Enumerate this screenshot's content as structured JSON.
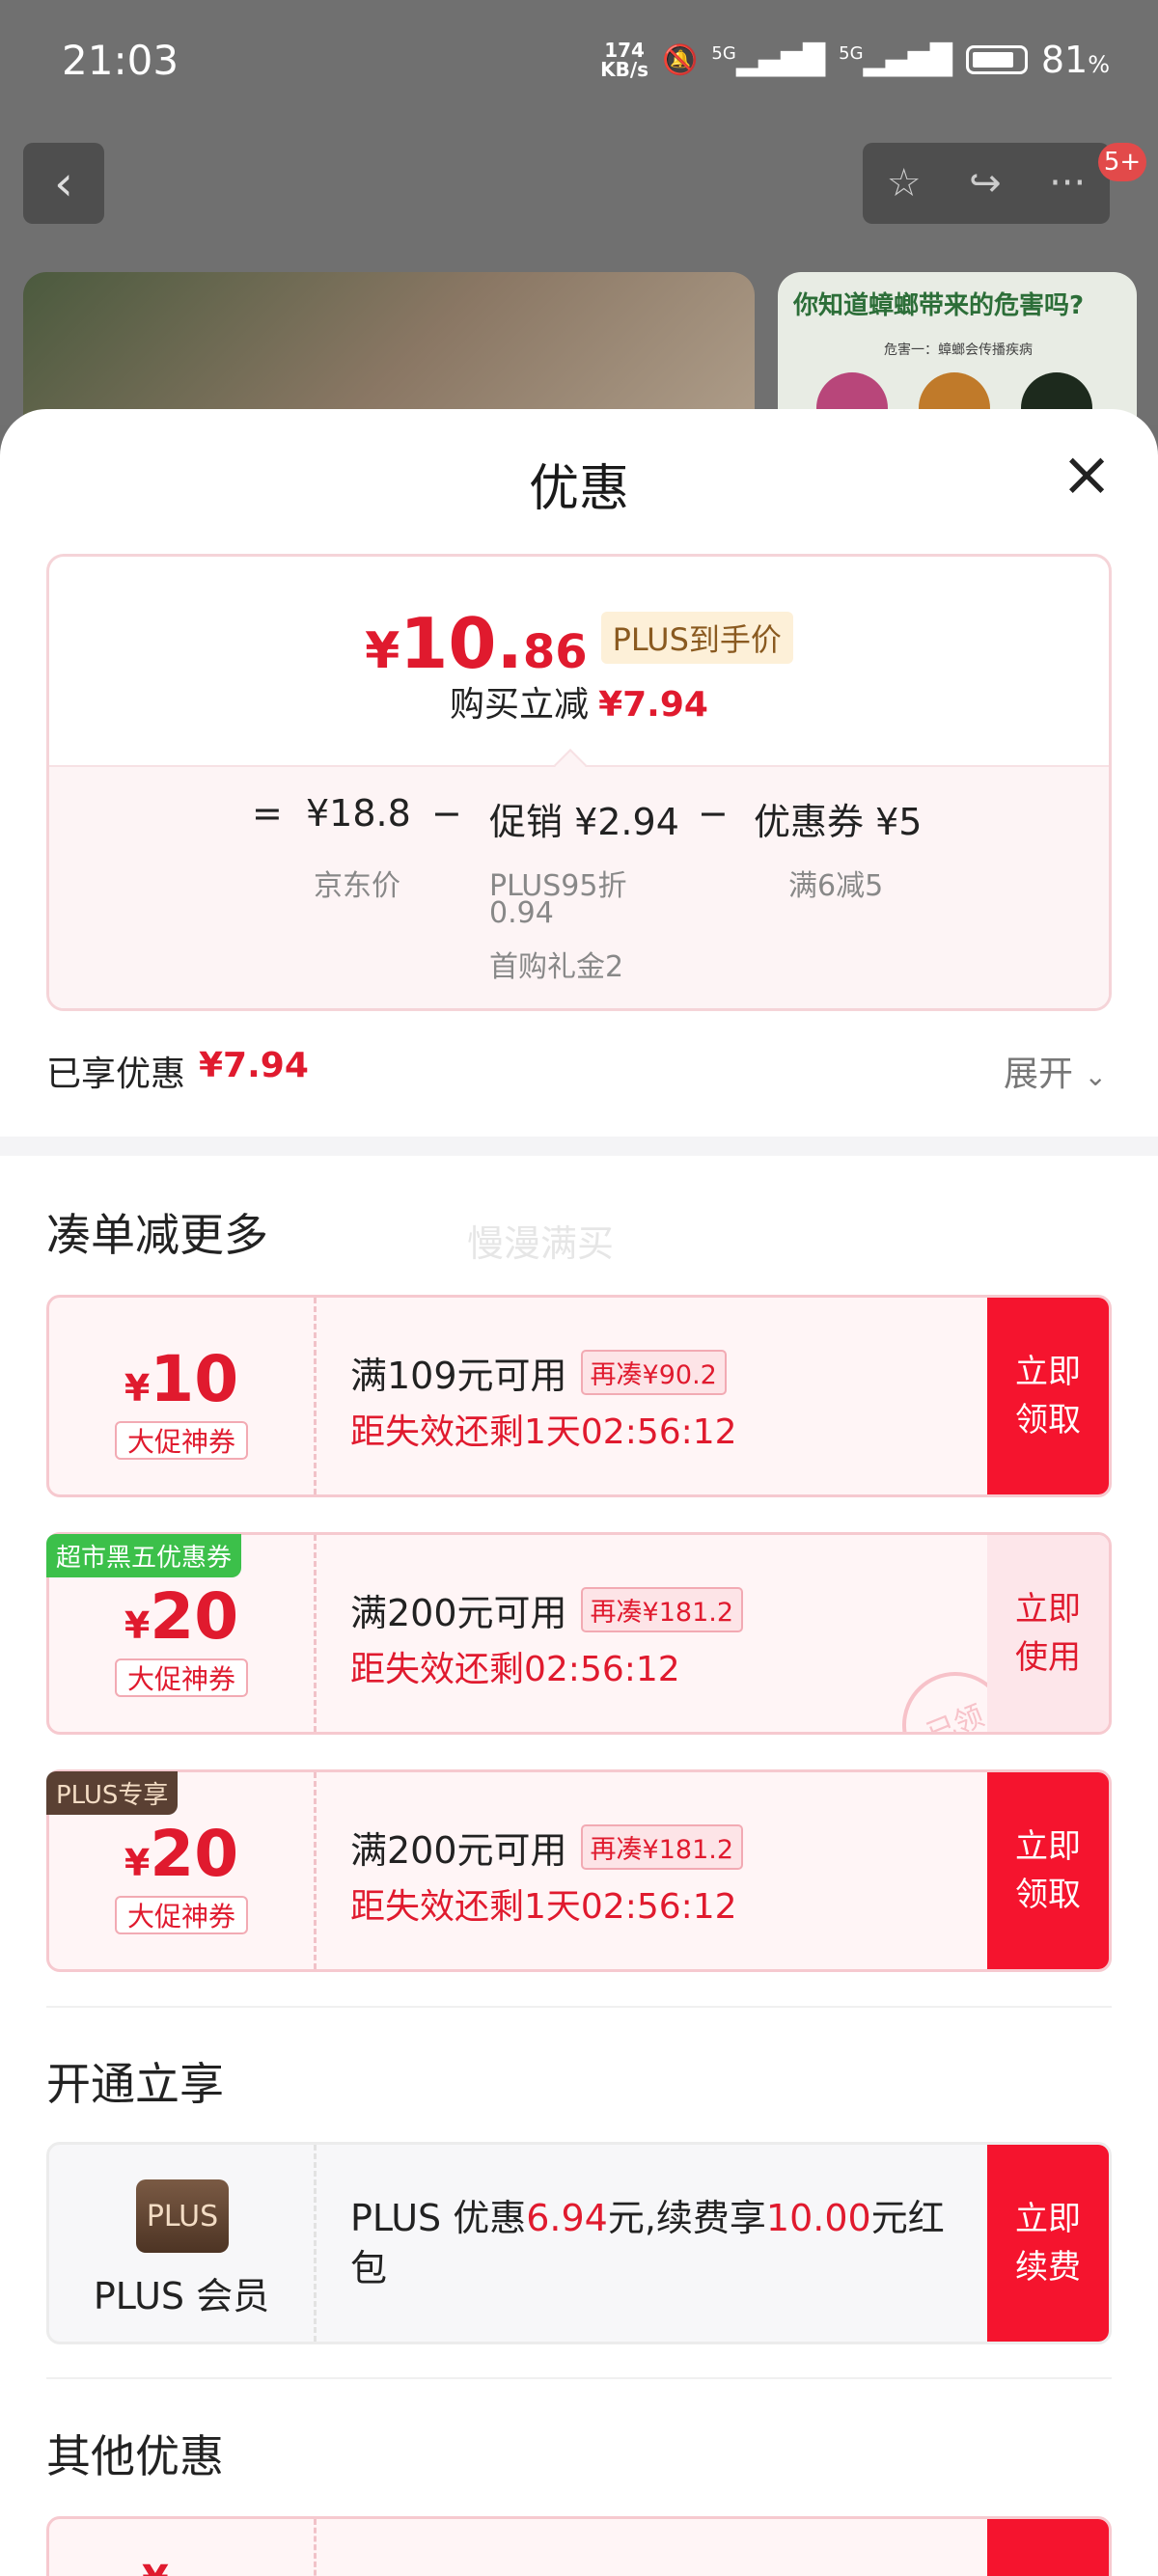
{
  "status_bar": {
    "time": "21:03",
    "net_speed_top": "174",
    "net_speed_unit": "KB/s",
    "sig1": "5G",
    "sig2": "5G",
    "battery": "81",
    "battery_unit": "%"
  },
  "nav": {
    "badge": "5+"
  },
  "background_promo": {
    "title": "你知道蟑螂带来的危害吗?",
    "sub": "危害一：蟑螂会传播疾病"
  },
  "sheet": {
    "title": "优惠",
    "summary": {
      "currency": "¥",
      "price_int": "10.",
      "price_dec": "86",
      "plus_tag": "PLUS到手价",
      "reduce_label": "购买立减",
      "reduce_value": "¥7.94",
      "equals": "=",
      "minus": "−",
      "jd_price": "¥18.8",
      "jd_label": "京东价",
      "promo": "促销 ¥2.94",
      "promo_sub1": "PLUS95折",
      "promo_sub1b": "0.94",
      "promo_sub2": "首购礼金2",
      "coupon": "优惠券 ¥5",
      "coupon_sub": "满6减5"
    },
    "enjoyed_label": "已享优惠",
    "enjoyed_value": "¥7.94",
    "expand_label": "展开",
    "section_more": "凑单减更多",
    "watermark": "慢漫满买",
    "coupons": [
      {
        "currency": "¥",
        "amount": "10",
        "tag": "大促神券",
        "condition": "满109元可用",
        "need": "再凑¥90.2",
        "timer": "距失效还剩1天02:56:12",
        "btn_line1": "立即",
        "btn_line2": "领取"
      },
      {
        "corner": "超市黑五优惠券",
        "currency": "¥",
        "amount": "20",
        "tag": "大促神券",
        "condition": "满200元可用",
        "need": "再凑¥181.2",
        "timer": "距失效还剩02:56:12",
        "btn_line1": "立即",
        "btn_line2": "使用",
        "stamp": "已领"
      },
      {
        "corner": "PLUS专享",
        "currency": "¥",
        "amount": "20",
        "tag": "大促神券",
        "condition": "满200元可用",
        "need": "再凑¥181.2",
        "timer": "距失效还剩1天02:56:12",
        "btn_line1": "立即",
        "btn_line2": "领取"
      }
    ],
    "section_open": "开通立享",
    "plus": {
      "logo": "PLUS",
      "name": "PLUS 会员",
      "desc_a": "PLUS 优惠",
      "desc_b": "6.94",
      "desc_c": "元,续费享",
      "desc_d": "10.00",
      "desc_e": "元红包",
      "btn_line1": "立即",
      "btn_line2": "续费"
    },
    "section_other": "其他优惠",
    "other_currency": "¥"
  },
  "colors": {
    "accent_red": "#f5142e",
    "price_red": "#e01a2e",
    "plus_gold": "#8a5a20",
    "green_tag": "#3cc04a",
    "plus_tag_dark": "#5a4033"
  }
}
